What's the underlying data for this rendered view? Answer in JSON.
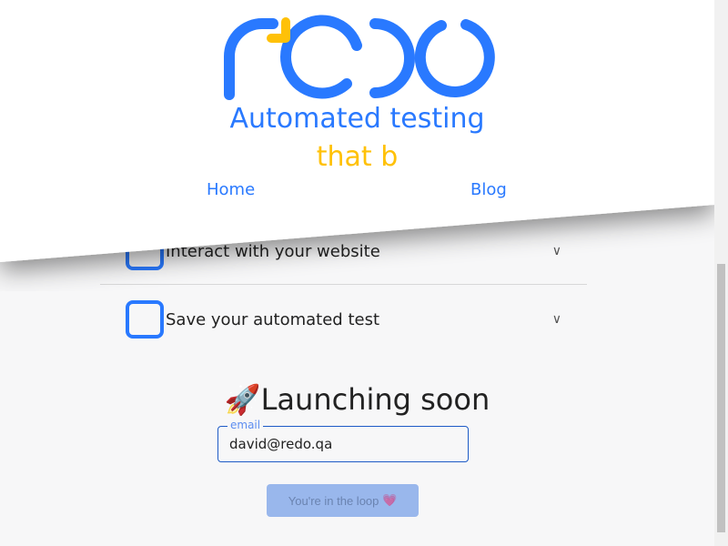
{
  "header": {
    "logo_text": "redo",
    "tagline_line1": "Automated testing",
    "tagline_line2": "that b",
    "nav": [
      {
        "label": "Home"
      },
      {
        "label": "Blog"
      }
    ]
  },
  "steps": [
    {
      "label": "Interact with your website",
      "icon": "chevron-down-icon"
    },
    {
      "label": "Save your automated test",
      "icon": "chevron-down-icon"
    }
  ],
  "signup": {
    "title": "Launching soon",
    "title_icon": "🚀",
    "email_label": "email",
    "email_value": "david@redo.qa",
    "button_label": "You're in the loop",
    "button_icon": "💗"
  },
  "colors": {
    "primary": "#2979ff",
    "accent": "#ffc107"
  }
}
